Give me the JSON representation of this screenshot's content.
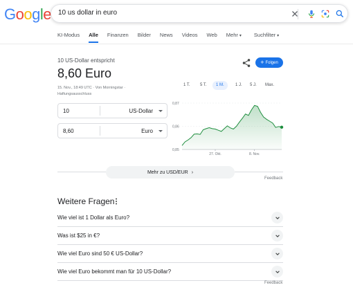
{
  "logo": {
    "letters": [
      {
        "ch": "G",
        "color": "#4285F4"
      },
      {
        "ch": "o",
        "color": "#EA4335"
      },
      {
        "ch": "o",
        "color": "#FBBC05"
      },
      {
        "ch": "g",
        "color": "#4285F4"
      },
      {
        "ch": "l",
        "color": "#34A853"
      },
      {
        "ch": "e",
        "color": "#EA4335"
      }
    ]
  },
  "search": {
    "query": "10 us dollar in euro"
  },
  "tabs": [
    {
      "label": "KI-Modus",
      "active": false
    },
    {
      "label": "Alle",
      "active": true
    },
    {
      "label": "Finanzen",
      "active": false
    },
    {
      "label": "Bilder",
      "active": false
    },
    {
      "label": "News",
      "active": false
    },
    {
      "label": "Videos",
      "active": false
    },
    {
      "label": "Web",
      "active": false
    },
    {
      "label": "Mehr",
      "active": false,
      "dropdown": true
    },
    {
      "label": "Suchfilter",
      "active": false,
      "dropdown": true
    }
  ],
  "converter": {
    "subtitle": "10 US-Dollar entspricht",
    "result": "8,60 Euro",
    "meta": "15. Nov., 18:49 UTC · Von Morningstar · Haftungsausschluss",
    "follow_label": "Folgen",
    "from": {
      "amount": "10",
      "currency": "US-Dollar"
    },
    "to": {
      "amount": "8,60",
      "currency": "Euro"
    },
    "more_label": "Mehr zu USD/EUR",
    "feedback": "Feedback"
  },
  "ranges": [
    {
      "label": "1 T.",
      "active": false
    },
    {
      "label": "5 T.",
      "active": false
    },
    {
      "label": "1 M.",
      "active": true
    },
    {
      "label": "1 J.",
      "active": false
    },
    {
      "label": "5 J.",
      "active": false
    },
    {
      "label": "Max.",
      "active": false
    }
  ],
  "chart_data": {
    "type": "area",
    "title": "",
    "ylim": [
      0.85,
      0.87
    ],
    "y_ticks": [
      "0,87",
      "0,86",
      "0,85"
    ],
    "x_ticks": [
      "27. Okt.",
      "8. Nov."
    ],
    "values": [
      0.8517,
      0.8533,
      0.8541,
      0.8551,
      0.8566,
      0.8567,
      0.8565,
      0.8585,
      0.859,
      0.8594,
      0.859,
      0.8588,
      0.8583,
      0.8578,
      0.859,
      0.8602,
      0.8593,
      0.8588,
      0.86,
      0.8618,
      0.8635,
      0.8653,
      0.8647,
      0.8671,
      0.869,
      0.8686,
      0.866,
      0.864,
      0.863,
      0.8622,
      0.8614,
      0.8595,
      0.8599,
      0.8596
    ],
    "color": "#1e8e3e"
  },
  "faq": {
    "title": "Weitere Fragen",
    "questions": [
      "Wie viel ist 1 Dollar als Euro?",
      "Was ist $25 in €?",
      "Wie viel Euro sind 50 € US-Dollar?",
      "Wie viel Euro bekommt man für 10 US-Dollar?"
    ],
    "feedback": "Feedback"
  }
}
